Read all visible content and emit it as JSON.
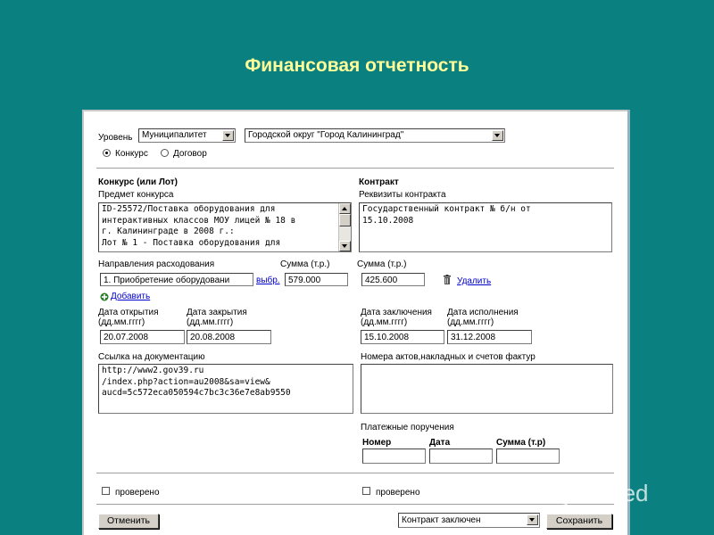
{
  "slide": {
    "title": "Финансовая отчетность"
  },
  "level": {
    "label": "Уровень",
    "select_value": "Муниципалитет",
    "region_value": "Городской округ \"Город Калининград\""
  },
  "type_radio": {
    "contest_label": "Конкурс",
    "contract_label": "Договор",
    "selected": "Конкурс"
  },
  "contest": {
    "header": "Конкурс (или Лот)",
    "subject_label": "Предмет конкурса",
    "subject_text": "ID-25572/Поставка оборудования для\nинтерактивных классов МОУ лицей № 18 в\nг. Калининграде в 2008 г.:\nЛот № 1 - Поставка оборудования для"
  },
  "contract": {
    "header": "Контракт",
    "details_label": "Реквизиты контракта",
    "details_text": "Государственный контракт № б/н от\n15.10.2008"
  },
  "expenses": {
    "direction_label": "Направления расходования",
    "sum_label_1": "Сумма (т.р.)",
    "sum_label_2": "Сумма (т.р.)",
    "direction_value": "1. Приобретение оборудовани",
    "choose_link": "выбр.",
    "sum_value_1": "579.000",
    "sum_value_2": "425.600",
    "delete_link": "Удалить",
    "add_link": "Добавить"
  },
  "dates": {
    "open_label": "Дата открытия",
    "close_label": "Дата закрытия",
    "conclusion_label": "Дата заключения",
    "execution_label": "Дата исполнения",
    "format": "(дд.мм.гггг)",
    "open_value": "20.07.2008",
    "close_value": "20.08.2008",
    "conclusion_value": "15.10.2008",
    "execution_value": "31.12.2008"
  },
  "docs": {
    "link_label": "Ссылка на документацию",
    "link_text": "http://www2.gov39.ru\n/index.php?action=au2008&sa=view&\naucd=5c572eca050594c7bc3c36e7e8ab9550",
    "acts_label": "Номера актов,накладных и счетов фактур",
    "acts_text": ""
  },
  "payments": {
    "label": "Платежные поручения",
    "col_number": "Номер",
    "col_date": "Дата",
    "col_sum": "Сумма (т.р)",
    "number_value": "",
    "date_value": "",
    "sum_value": ""
  },
  "verify": {
    "left_label": "проверено",
    "right_label": "проверено"
  },
  "footer": {
    "cancel_label": "Отменить",
    "status_value": "Контракт заключен",
    "save_label": "Сохранить"
  },
  "watermark": {
    "text": "MyShared"
  }
}
